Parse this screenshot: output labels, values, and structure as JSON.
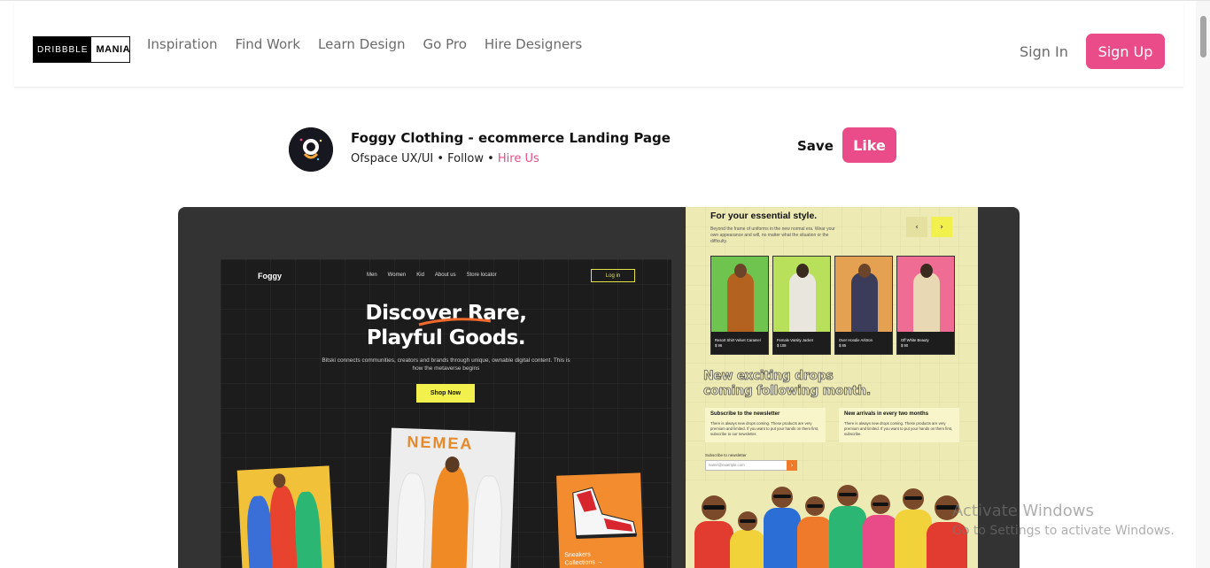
{
  "header": {
    "logo_left": "DRIBBBLE",
    "logo_right": "MANIA",
    "nav": [
      "Inspiration",
      "Find Work",
      "Learn Design",
      "Go Pro",
      "Hire Designers"
    ],
    "sign_in": "Sign In",
    "sign_up": "Sign Up"
  },
  "shot": {
    "title": "Foggy Clothing - ecommerce Landing Page",
    "author": "Ofspace UX/UI",
    "sep1": " • ",
    "follow": "Follow",
    "sep2": " • ",
    "hire": "Hire Us",
    "save": "Save",
    "like": "Like"
  },
  "preview": {
    "brand": "Foggy",
    "mini_nav": [
      "Men",
      "Women",
      "Kid",
      "About us",
      "Store locator"
    ],
    "login": "Log in",
    "hero_line1": "Discover Rare,",
    "hero_line2": "Playful Goods.",
    "hero_sub": "Bitski connects communities, creators and brands through unique, ownable digital content. This is how the metaverse begins",
    "shop_now": "Shop Now",
    "nemea": "NEMEA",
    "sneakers_line1": "Sneakers",
    "sneakers_line2": "Collections →",
    "rp_title": "For your essential style.",
    "rp_desc": "Beyond the frame of uniforms in the new normal era. Wear your own appearance and will, no matter what the situation or the difficulty.",
    "products": [
      {
        "name": "Resort Shirt Velvet Caramel",
        "price": "$ 96"
      },
      {
        "name": "Female Varsity Jacket",
        "price": "$ 108"
      },
      {
        "name": "Over Hoodie Arktron",
        "price": "$ 85"
      },
      {
        "name": "Off White Beauty",
        "price": "$ 90"
      }
    ],
    "drops_line1": "New exciting drops",
    "drops_line2": "coming following month.",
    "box1_title": "Subscribe to the newsletter",
    "box1_desc": "There is always new drops coming. These products are very premium and limited. If you want to put your hands on them first, subscribe to our newsletter.",
    "box2_title": "New arrivals in every two months",
    "box2_desc": "There is always new drops coming. These products are very premium and limited. If you want to put your hands on them first, subscribe.",
    "subscribe_label": "Subscribe to newsletter",
    "subscribe_placeholder": "name@example.com"
  },
  "os": {
    "activate_title": "Activate Windows",
    "activate_sub": "Go to Settings to activate Windows."
  },
  "colors": {
    "accent": "#ea4c89",
    "yellow": "#f2f04c"
  }
}
